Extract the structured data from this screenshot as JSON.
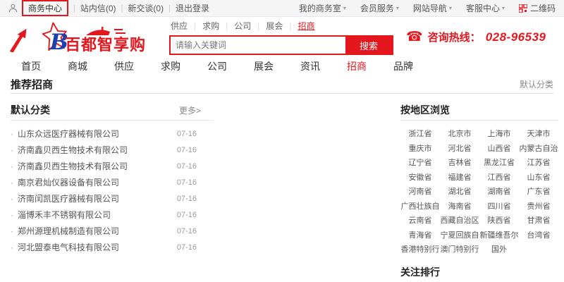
{
  "colors": {
    "accent": "#e4161e",
    "logo_blue": "#1f3fae"
  },
  "icons": {
    "separator": "|",
    "caret": "▾",
    "phone": "☎",
    "bullet": "·"
  },
  "topbar": {
    "business_center": "商务中心",
    "links": [
      "站内信(0)",
      "新交谈(0)",
      "退出登录"
    ],
    "right_menus": [
      "我的商务室",
      "会员服务",
      "网站导航",
      "客服中心"
    ],
    "qr_label": "二维码"
  },
  "header": {
    "logo_b": "B",
    "logo_text": "百都智享购",
    "quick_links": [
      "供应",
      "求购",
      "公司",
      "展会",
      "招商"
    ],
    "search": {
      "placeholder": "请输入关键词",
      "button": "搜索"
    },
    "hotline_label": "咨询热线：",
    "hotline_number": "028-96539"
  },
  "nav": {
    "items": [
      "首页",
      "商城",
      "供应",
      "求购",
      "公司",
      "展会",
      "资讯",
      "招商",
      "品牌"
    ]
  },
  "section": {
    "title": "推荐招商",
    "right_label": "默认分类"
  },
  "left_panel": {
    "title": "默认分类",
    "more": "更多>",
    "items": [
      {
        "name": "山东众远医疗器械有限公司",
        "date": "07-16"
      },
      {
        "name": "济南鑫贝西生物技术有限公司",
        "date": "07-16"
      },
      {
        "name": "济南鑫贝西生物技术有限公司",
        "date": "07-16"
      },
      {
        "name": "南京君灿仪器设备有限公司",
        "date": "07-16"
      },
      {
        "name": "济南闰凯医疗器械有限公司",
        "date": "07-16"
      },
      {
        "name": "淄博禾丰不锈钢有限公司",
        "date": "07-16"
      },
      {
        "name": "郑州源理机械制造有限公司",
        "date": "07-16"
      },
      {
        "name": "河北盟泰电气科技有限公司",
        "date": "07-16"
      }
    ]
  },
  "region_panel": {
    "title": "按地区浏览",
    "regions": [
      "浙江省",
      "北京市",
      "上海市",
      "天津市",
      "重庆市",
      "河北省",
      "山西省",
      "内蒙古自治",
      "辽宁省",
      "吉林省",
      "黑龙江省",
      "江苏省",
      "安徽省",
      "福建省",
      "江西省",
      "山东省",
      "河南省",
      "湖北省",
      "湖南省",
      "广东省",
      "广西壮族自",
      "海南省",
      "四川省",
      "贵州省",
      "云南省",
      "西藏自治区",
      "陕西省",
      "甘肃省",
      "青海省",
      "宁夏回族自",
      "新疆维吾尔",
      "台湾省",
      "香港特别行",
      "澳门特别行",
      "国外"
    ]
  },
  "follow_panel": {
    "title": "关注排行"
  }
}
